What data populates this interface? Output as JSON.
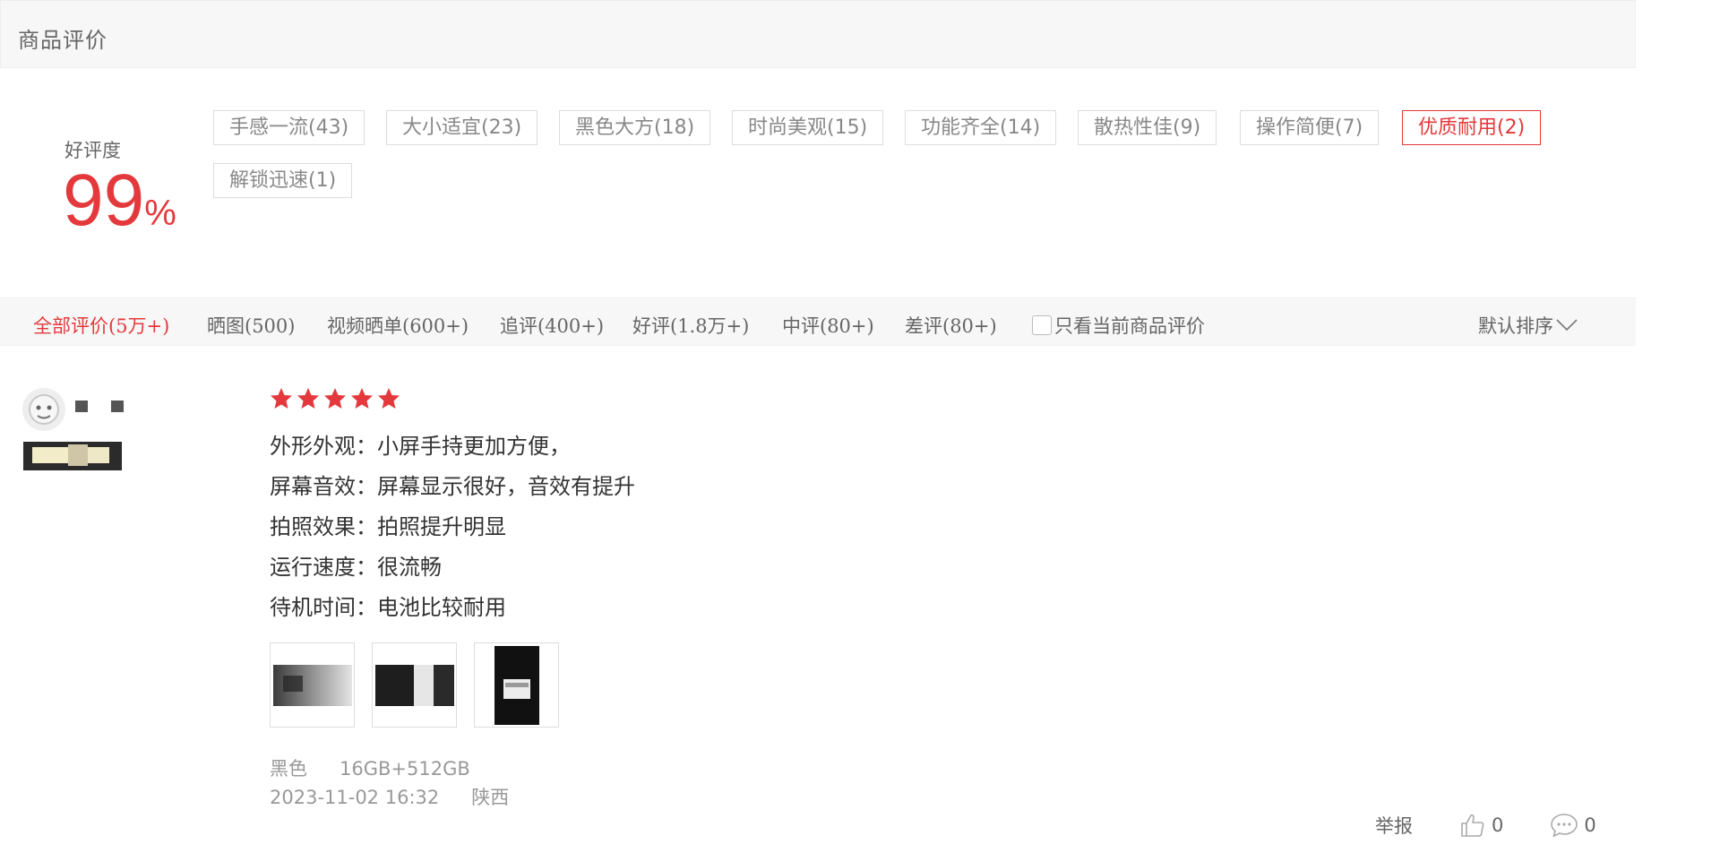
{
  "section": {
    "title": "商品评价"
  },
  "rating": {
    "label": "好评度",
    "value": "99",
    "unit": "%"
  },
  "tags": [
    {
      "label": "手感一流(43)",
      "active": false
    },
    {
      "label": "大小适宜(23)",
      "active": false
    },
    {
      "label": "黑色大方(18)",
      "active": false
    },
    {
      "label": "时尚美观(15)",
      "active": false
    },
    {
      "label": "功能齐全(14)",
      "active": false
    },
    {
      "label": "散热性佳(9)",
      "active": false
    },
    {
      "label": "操作简便(7)",
      "active": false
    },
    {
      "label": "优质耐用(2)",
      "active": true
    },
    {
      "label": "解锁迅速(1)",
      "active": false
    }
  ],
  "filters": {
    "tabs": [
      {
        "label": "全部评价(5万+)",
        "active": true
      },
      {
        "label": "晒图(500)",
        "active": false
      },
      {
        "label": "视频晒单(600+)",
        "active": false
      },
      {
        "label": "追评(400+)",
        "active": false
      },
      {
        "label": "好评(1.8万+)",
        "active": false
      },
      {
        "label": "中评(80+)",
        "active": false
      },
      {
        "label": "差评(80+)",
        "active": false
      }
    ],
    "only_current_label": "只看当前商品评价",
    "only_current_checked": false,
    "sort_label": "默认排序"
  },
  "review": {
    "stars": 5,
    "star_color": "#e4393c",
    "lines": [
      "外形外观：小屏手持更加方便，",
      "屏幕音效：屏幕显示很好，音效有提升",
      "拍照效果：拍照提升明显",
      "运行速度：很流畅",
      "待机时间：电池比较耐用"
    ],
    "photos": [
      "photo-1",
      "photo-2",
      "photo-3"
    ],
    "color": "黑色",
    "spec": "16GB+512GB",
    "date": "2023-11-02 16:32",
    "location": "陕西",
    "report_label": "举报",
    "like_count": "0",
    "reply_count": "0"
  },
  "colors": {
    "accent": "#e4393c",
    "muted": "#999999",
    "header_bg": "#f7f7f7"
  }
}
